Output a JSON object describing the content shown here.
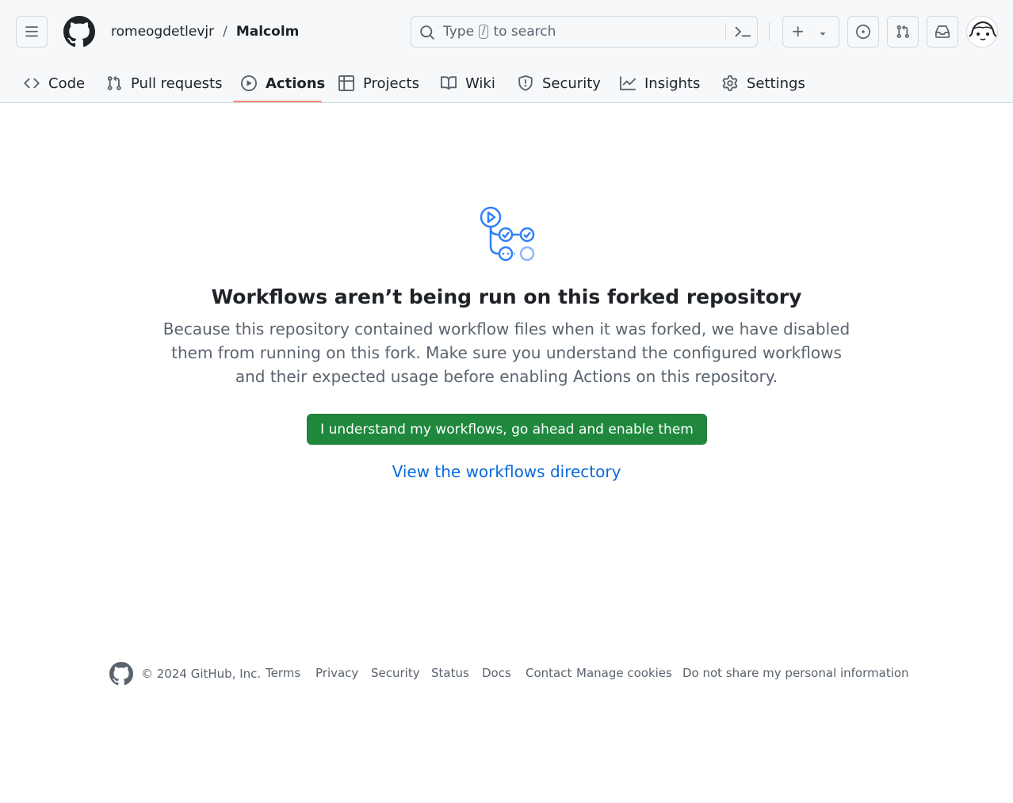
{
  "header": {
    "owner": "romeogdetlevjr",
    "separator": "/",
    "repo": "Malcolm",
    "search": {
      "prefix": "Type",
      "shortcut": "/",
      "suffix": "to search"
    }
  },
  "tabs": [
    {
      "label": "Code",
      "icon": "code-icon"
    },
    {
      "label": "Pull requests",
      "icon": "git-pull-request-icon"
    },
    {
      "label": "Actions",
      "icon": "play-icon",
      "active": true
    },
    {
      "label": "Projects",
      "icon": "table-icon"
    },
    {
      "label": "Wiki",
      "icon": "book-icon"
    },
    {
      "label": "Security",
      "icon": "shield-icon"
    },
    {
      "label": "Insights",
      "icon": "graph-icon"
    },
    {
      "label": "Settings",
      "icon": "gear-icon"
    }
  ],
  "main": {
    "title": "Workflows aren’t being run on this forked repository",
    "description": "Because this repository contained workflow files when it was forked, we have disabled them from running on this fork. Make sure you understand the configured workflows and their expected usage before enabling Actions on this repository.",
    "enable_button": "I understand my workflows, go ahead and enable them",
    "view_link": "View the workflows directory"
  },
  "footer": {
    "copyright": "© 2024 GitHub, Inc.",
    "links": [
      "Terms",
      "Privacy",
      "Security",
      "Status",
      "Docs",
      "Contact",
      "Manage cookies",
      "Do not share my personal information"
    ]
  },
  "colors": {
    "accent_tab": "#fd8c73",
    "primary_button": "#1f883d",
    "link": "#0969da",
    "actions_icon": "#2f81f7"
  }
}
